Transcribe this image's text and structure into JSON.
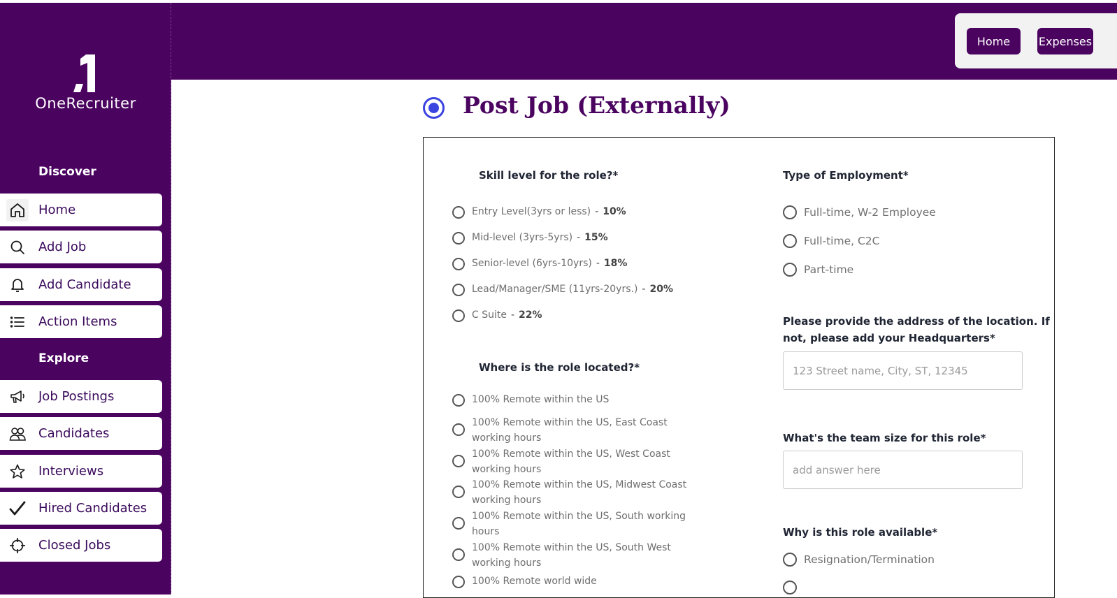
{
  "app": {
    "logo_text": "OneRecruiter",
    "accent_color": "#4b0360",
    "radio_accent_color": "#3b43e0"
  },
  "sidebar": {
    "sections": [
      {
        "title": "Discover",
        "items": [
          {
            "label": "Home",
            "icon": "home-icon"
          },
          {
            "label": "Add Job",
            "icon": "search-icon"
          },
          {
            "label": "Add Candidate",
            "icon": "bell-icon"
          },
          {
            "label": "Action Items",
            "icon": "list-icon"
          }
        ]
      },
      {
        "title": "Explore",
        "items": [
          {
            "label": "Job Postings",
            "icon": "megaphone-icon"
          },
          {
            "label": "Candidates",
            "icon": "users-icon"
          },
          {
            "label": "Interviews",
            "icon": "star-icon"
          },
          {
            "label": "Hired Candidates",
            "icon": "checkmark-icon"
          },
          {
            "label": "Closed Jobs",
            "icon": "crosshair-icon"
          }
        ]
      }
    ]
  },
  "header": {
    "buttons": [
      {
        "label": "Home"
      },
      {
        "label": "Expenses"
      }
    ]
  },
  "page": {
    "title": "Post Job (Externally)"
  },
  "form": {
    "skill_level": {
      "label": "Skill level for the role?*",
      "options": [
        {
          "text": "Entry Level(3yrs or less)",
          "sep": "-",
          "pct": "10%"
        },
        {
          "text": "Mid-level (3yrs-5yrs)",
          "sep": "-",
          "pct": "15%"
        },
        {
          "text": "Senior-level (6yrs-10yrs)",
          "sep": "-",
          "pct": "18%"
        },
        {
          "text": "Lead/Manager/SME (11yrs-20yrs.)",
          "sep": "-",
          "pct": "20%"
        },
        {
          "text": "C Suite",
          "sep": "-",
          "pct": "22%"
        }
      ]
    },
    "location": {
      "label": "Where is the role located?*",
      "options": [
        {
          "line1": "100% Remote within the US",
          "line2": ""
        },
        {
          "line1": "100% Remote within the US, East Coast",
          "line2": "working hours"
        },
        {
          "line1": "100% Remote within the US, West Coast",
          "line2": "working hours"
        },
        {
          "line1": "100% Remote within the US, Midwest Coast",
          "line2": "working hours"
        },
        {
          "line1": "100% Remote within the US, South working",
          "line2": "hours"
        },
        {
          "line1": "100% Remote within the US, South West",
          "line2": "working hours"
        },
        {
          "line1": "100% Remote world wide",
          "line2": ""
        }
      ]
    },
    "employment_type": {
      "label": "Type of Employment*",
      "options": [
        "Full-time, W-2 Employee",
        "Full-time, C2C",
        "Part-time"
      ]
    },
    "address": {
      "label_line1": "Please provide the address of the location. If",
      "label_line2": "not, please add your Headquarters*",
      "placeholder": "123 Street name, City, ST, 12345",
      "value": ""
    },
    "team_size": {
      "label": "What's the team size for this role*",
      "placeholder": "add answer here",
      "value": ""
    },
    "role_available": {
      "label": "Why is this role available*",
      "options": [
        "Resignation/Termination"
      ]
    }
  }
}
